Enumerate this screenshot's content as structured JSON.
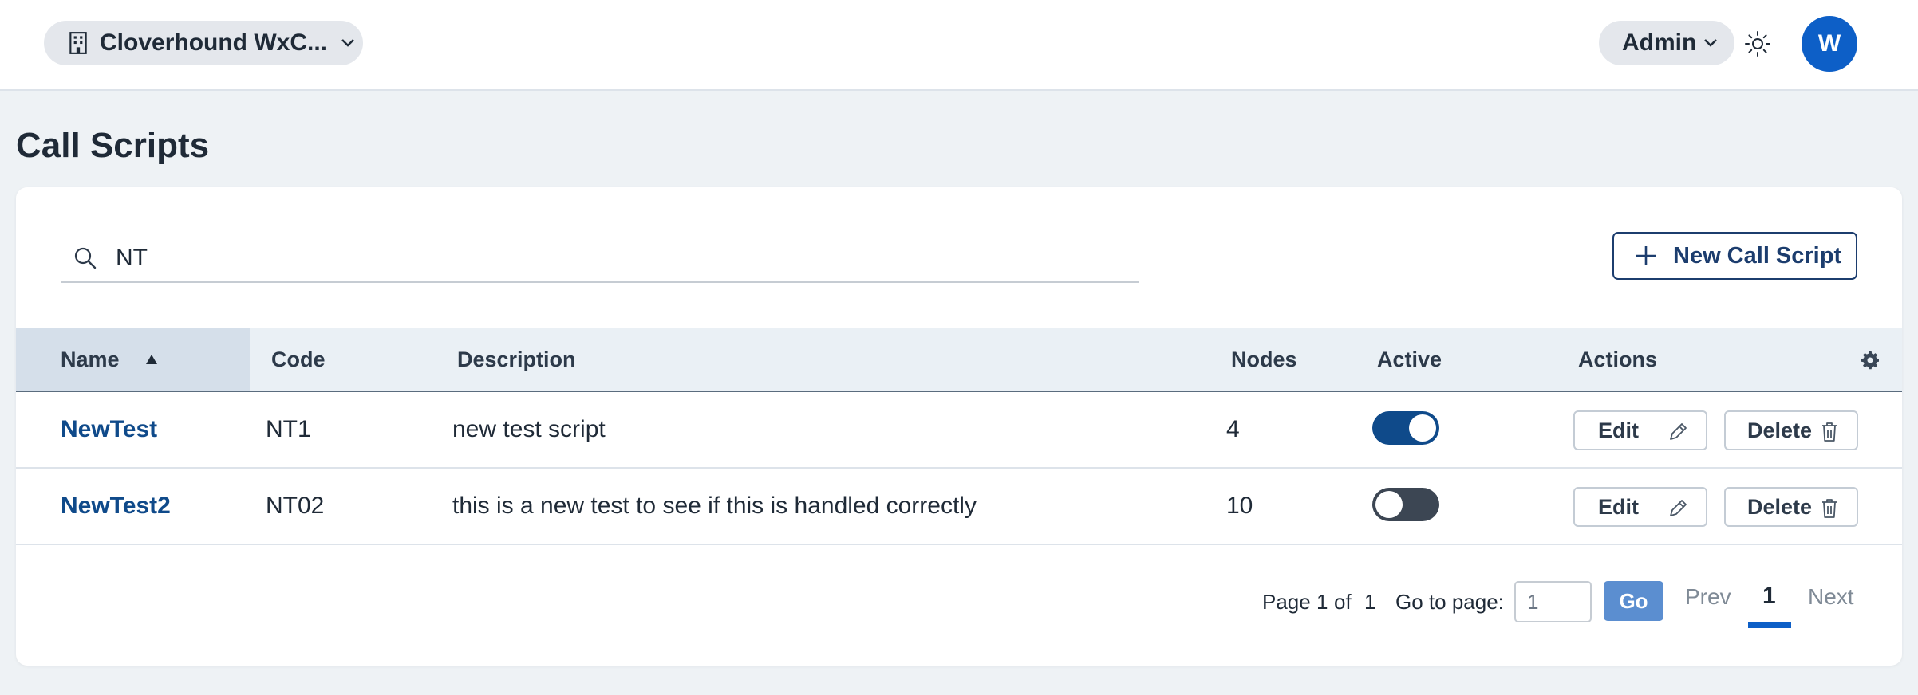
{
  "header": {
    "org_name": "Cloverhound WxC...",
    "role_label": "Admin",
    "avatar_initial": "W"
  },
  "page": {
    "title": "Call Scripts"
  },
  "toolbar": {
    "search_value": "NT",
    "new_button_label": "New Call Script"
  },
  "table": {
    "columns": {
      "name": "Name",
      "code": "Code",
      "description": "Description",
      "nodes": "Nodes",
      "active": "Active",
      "actions": "Actions"
    },
    "sort": {
      "column": "Name",
      "direction": "ascending"
    },
    "rows": [
      {
        "name": "NewTest",
        "code": "NT1",
        "description": "new test script",
        "nodes": "4",
        "active": true
      },
      {
        "name": "NewTest2",
        "code": "NT02",
        "description": "this is a new test to see if this is handled correctly",
        "nodes": "10",
        "active": false
      }
    ],
    "edit_label": "Edit",
    "delete_label": "Delete"
  },
  "pagination": {
    "page_label": "Page 1",
    "of_label": "of",
    "total_pages": "1",
    "goto_label": "Go to page:",
    "goto_value": "1",
    "go_label": "Go",
    "prev_label": "Prev",
    "current_page": "1",
    "next_label": "Next"
  },
  "colors": {
    "primary": "#0f4a8a",
    "avatar": "#0d5fc7",
    "go_button": "#5b8ed0",
    "background": "#eef2f5"
  },
  "icons": [
    "building-icon",
    "chevron-down-icon",
    "sun-icon",
    "search-icon",
    "plus-icon",
    "sort-up-icon",
    "gear-icon",
    "pencil-icon",
    "trash-icon"
  ]
}
